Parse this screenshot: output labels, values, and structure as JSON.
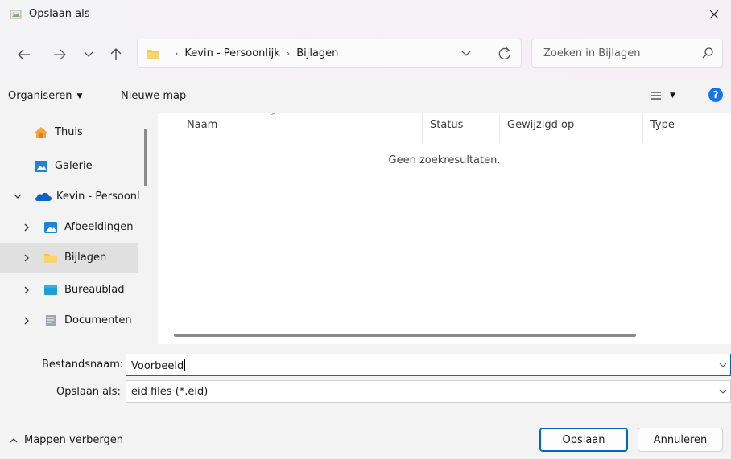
{
  "window": {
    "title": "Opslaan als",
    "close_label": "×"
  },
  "address": {
    "crumbs": [
      "Kevin - Persoonlijk",
      "Bijlagen"
    ]
  },
  "search": {
    "placeholder": "Zoeken in Bijlagen"
  },
  "toolbar": {
    "organize_label": "Organiseren",
    "new_folder_label": "Nieuwe map",
    "help_label": "?"
  },
  "nav": {
    "items": [
      {
        "label": "Thuis",
        "icon": "home-icon"
      },
      {
        "label": "Galerie",
        "icon": "gallery-icon"
      },
      {
        "label": "Kevin - Persoonl",
        "icon": "onedrive-icon",
        "expanded": true
      },
      {
        "label": "Afbeeldingen",
        "icon": "pictures-icon"
      },
      {
        "label": "Bijlagen",
        "icon": "folder-icon",
        "selected": true
      },
      {
        "label": "Bureaublad",
        "icon": "desktop-icon"
      },
      {
        "label": "Documenten",
        "icon": "documents-icon"
      }
    ]
  },
  "files": {
    "columns": [
      "Naam",
      "Status",
      "Gewijzigd op",
      "Type"
    ],
    "empty_message": "Geen zoekresultaten."
  },
  "form": {
    "filename_label": "Bestandsnaam:",
    "filename_value": "Voorbeeld",
    "filetype_label": "Opslaan als:",
    "filetype_value": "eid files (*.eid)"
  },
  "footer": {
    "hide_folders_label": "Mappen verbergen",
    "save_label": "Opslaan",
    "cancel_label": "Annuleren"
  },
  "colors": {
    "accent": "#0067c0",
    "folder": "#f5c542",
    "onedrive": "#0a64c8",
    "help": "#1a73e8"
  }
}
